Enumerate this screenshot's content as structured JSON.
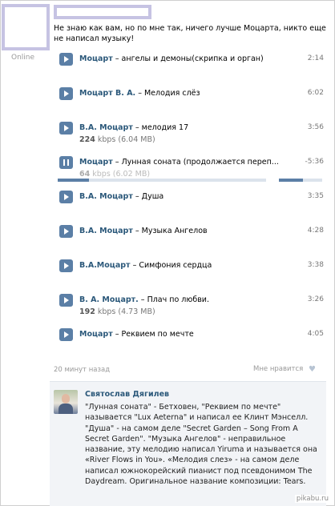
{
  "author": {
    "status": "Online"
  },
  "post": {
    "text": "Не знаю как вам, но по мне так, ничего лучше Моцарта, никто еще не написал музыку!"
  },
  "tracks": [
    {
      "artist": "Моцарт",
      "title": " – ангелы и демоны(скрипка и орган)",
      "duration": "2:14",
      "bitrate": "",
      "size": ""
    },
    {
      "artist": "Моцарт В. А.",
      "title": " – Мелодия слёз",
      "duration": "6:02",
      "bitrate": "",
      "size": ""
    },
    {
      "artist": "В.А. Моцарт",
      "title": " – мелодия 17",
      "duration": "3:56",
      "bitrate": "224",
      "size": " kbps (6.04 MB)"
    },
    {
      "artist": "Моцарт",
      "title": " – Лунная соната (продолжается переп...",
      "duration": "-5:36",
      "bitrate": "64",
      "size": " kbps (6.02 MB)",
      "playing": true,
      "progress": 0.15,
      "volume": 0.55
    },
    {
      "artist": "В.А. Моцарт",
      "title": " – Душа",
      "duration": "3:35",
      "bitrate": "",
      "size": ""
    },
    {
      "artist": "В.А. Моцарт",
      "title": " – Музыка Ангелов",
      "duration": "4:28",
      "bitrate": "",
      "size": ""
    },
    {
      "artist": "В.А.Моцарт",
      "title": " – Симфония сердца",
      "duration": "3:38",
      "bitrate": "",
      "size": ""
    },
    {
      "artist": "В. А. Моцарт.",
      "title": " – Плач по любви.",
      "duration": "3:26",
      "bitrate": "192",
      "size": " kbps (4.73 MB)"
    },
    {
      "artist": "Моцарт",
      "title": " – Реквием по мечте",
      "duration": "4:05",
      "bitrate": "",
      "size": ""
    }
  ],
  "footer": {
    "time": "20 минут назад",
    "like": "Мне нравится",
    "heart_icon": "♥"
  },
  "comment": {
    "author": "Святослав Дягилев",
    "text": "\"Лунная соната\" - Бетховен, \"Реквием по мечте\" называется \"Lux Aeterna\" и написал ее Клинт Мэнселл. \"Душа\" - на самом деле \"Secret Garden – Song From A Secret Garden\". \"Музыка Ангелов\" - неправильное название, эту мелодию написал Yiruma и называется она «River Flows in You». «Мелодия слез» - на самом деле написал южнокорейский пианист под псевдонимом The Daydream. Оригинальное название композиции: Tears."
  },
  "watermark": "pikabu.ru",
  "colors": {
    "accent": "#5b7fa6",
    "link": "#2b587a",
    "placeholder_border": "#c6c3e3"
  }
}
